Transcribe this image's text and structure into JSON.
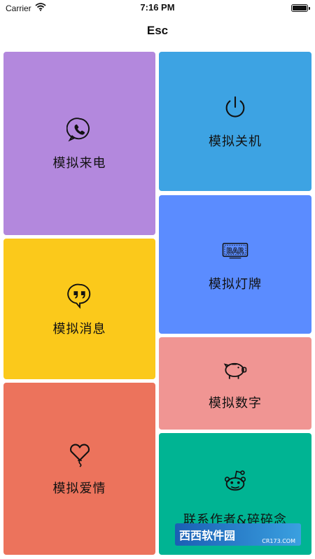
{
  "status_bar": {
    "carrier": "Carrier",
    "time": "7:16 PM"
  },
  "nav": {
    "title": "Esc"
  },
  "tiles": [
    {
      "label": "模拟来电",
      "icon": "whatsapp-phone-icon",
      "color": "#b388dd"
    },
    {
      "label": "模拟关机",
      "icon": "power-icon",
      "color": "#3da3e3"
    },
    {
      "label": "模拟灯牌",
      "icon": "bar-sign-icon",
      "color": "#5b8cff"
    },
    {
      "label": "模拟消息",
      "icon": "quote-bubble-icon",
      "color": "#fbc91b"
    },
    {
      "label": "模拟数字",
      "icon": "piggy-bank-icon",
      "color": "#f09593"
    },
    {
      "label": "模拟爱情",
      "icon": "heart-balloon-icon",
      "color": "#ec735c"
    },
    {
      "label": "联系作者&碎碎念",
      "icon": "reddit-alien-icon",
      "color": "#00b493"
    }
  ],
  "watermark": {
    "text": "西西软件园",
    "sub": "CR173.COM"
  }
}
